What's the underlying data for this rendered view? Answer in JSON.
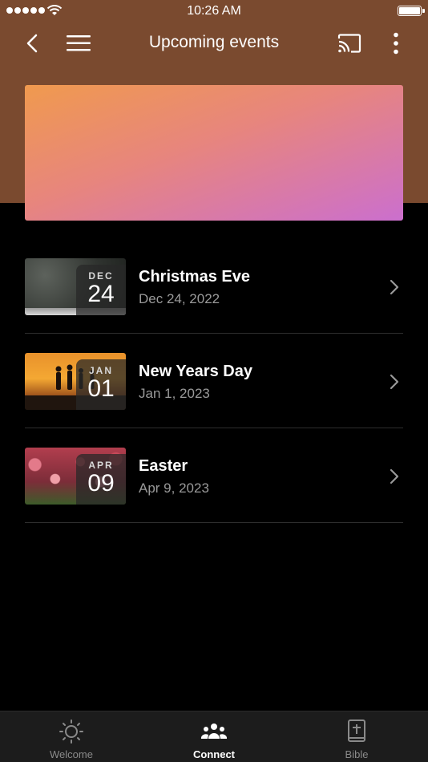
{
  "status_bar": {
    "time": "10:26 AM"
  },
  "header": {
    "title": "Upcoming events"
  },
  "events": [
    {
      "month": "DEC",
      "day": "24",
      "title": "Christmas Eve",
      "date": "Dec 24, 2022"
    },
    {
      "month": "JAN",
      "day": "01",
      "title": "New Years Day",
      "date": "Jan 1, 2023"
    },
    {
      "month": "APR",
      "day": "09",
      "title": "Easter",
      "date": "Apr 9, 2023"
    }
  ],
  "tab_bar": {
    "tabs": [
      {
        "label": "Welcome",
        "icon": "sun-icon",
        "active": false
      },
      {
        "label": "Connect",
        "icon": "people-icon",
        "active": true
      },
      {
        "label": "Bible",
        "icon": "bible-icon",
        "active": false
      }
    ]
  },
  "colors": {
    "header_bg": "#7a4a2f",
    "hero_gradient_start": "#f09a4e",
    "hero_gradient_end": "#cb6fce",
    "secondary_text": "#9a9a9a"
  }
}
